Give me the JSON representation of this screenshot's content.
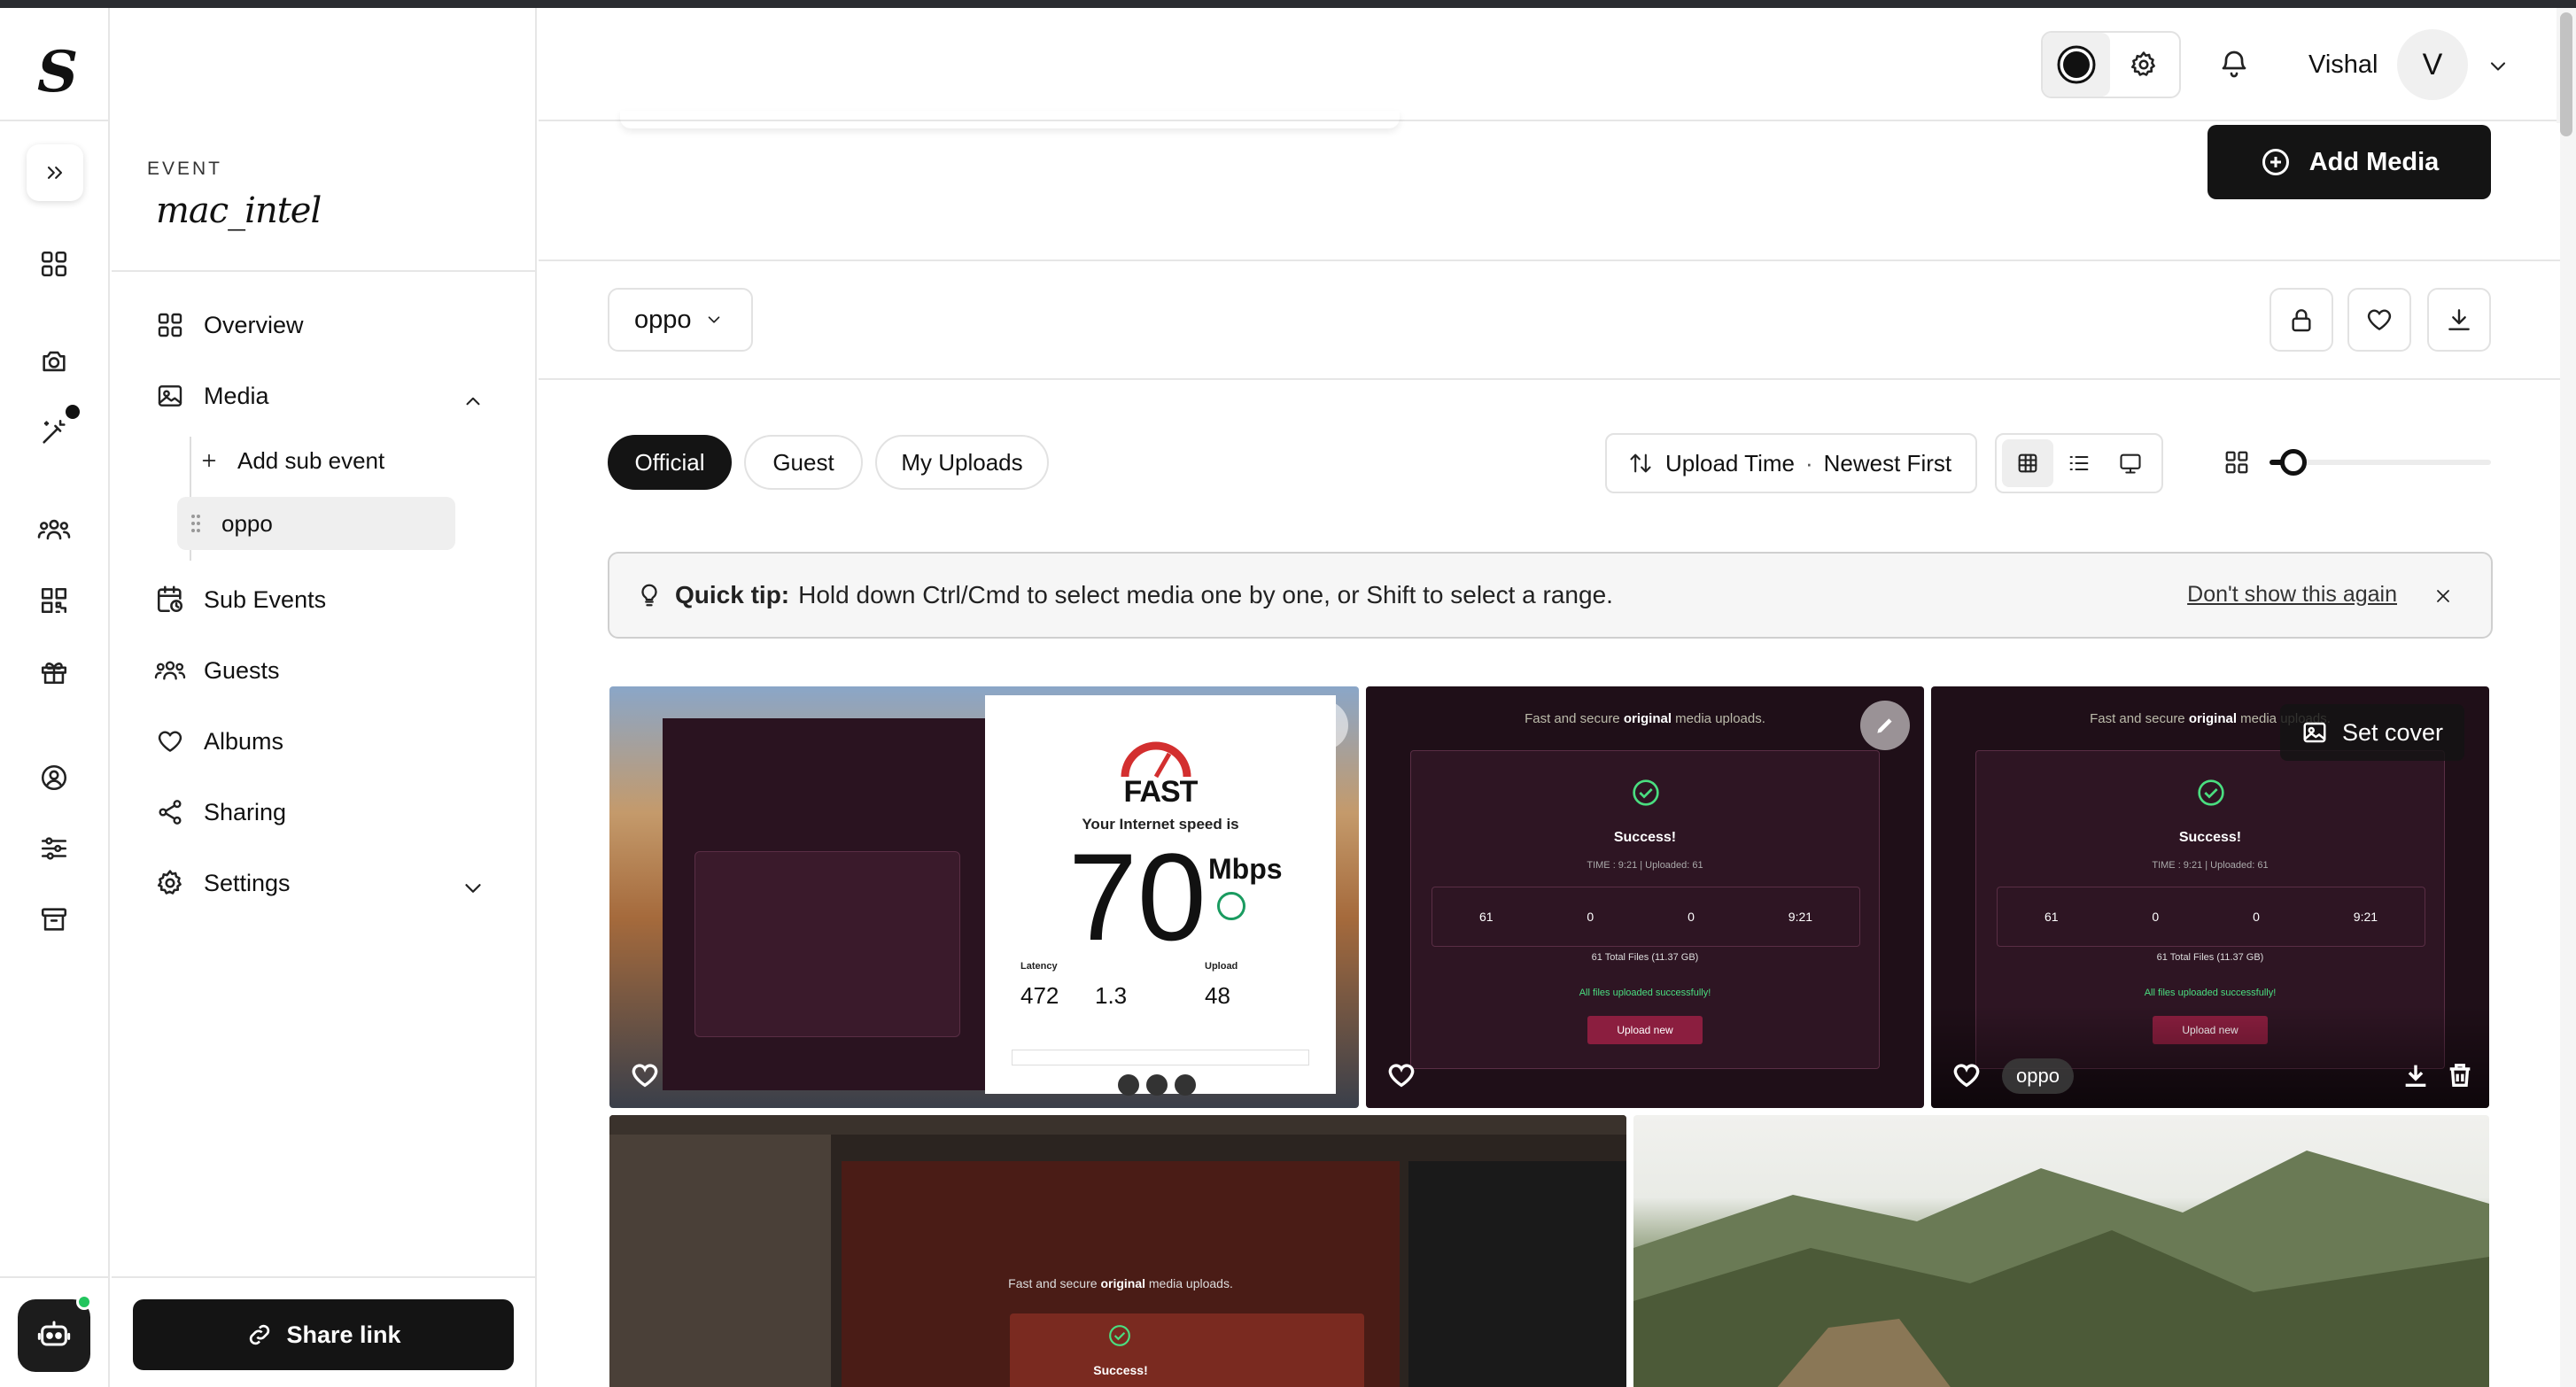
{
  "app": {
    "logo_letter": "S"
  },
  "header": {
    "user_name": "Vishal",
    "avatar_initial": "V"
  },
  "event": {
    "label": "EVENT",
    "name": "mac_intel"
  },
  "nav": {
    "overview": "Overview",
    "media": "Media",
    "add_sub_event": "Add sub event",
    "current_sub_event": "oppo",
    "sub_events": "Sub Events",
    "guests": "Guests",
    "albums": "Albums",
    "sharing": "Sharing",
    "settings": "Settings",
    "share_link": "Share link"
  },
  "toolbar": {
    "add_media": "Add Media",
    "sub_event_select": "oppo"
  },
  "filters": {
    "tabs": [
      {
        "label": "Official",
        "active": true
      },
      {
        "label": "Guest",
        "active": false
      },
      {
        "label": "My Uploads",
        "active": false
      }
    ],
    "sort_field": "Upload Time",
    "sort_dot": "·",
    "sort_order": "Newest First",
    "zoom_level": 0.05
  },
  "tip": {
    "title": "Quick tip:",
    "text": "Hold down Ctrl/Cmd to select media one by one, or Shift to select a range.",
    "dismiss": "Don't show this again"
  },
  "media": {
    "tile1": {
      "fast_logo": "FAST",
      "speed_caption": "Your Internet speed is",
      "speed_value": "70",
      "speed_unit": "Mbps",
      "latency_label": "Latency",
      "upload_label": "Upload",
      "latency_value": "472",
      "loaded_value": "1.3",
      "upload_value": "48"
    },
    "success_tile": {
      "tagline_prefix": "Fast and secure ",
      "tagline_bold": "original",
      "tagline_suffix": " media uploads.",
      "success": "Success!",
      "time_line": "TIME : 9:21 | Uploaded: 61",
      "uploaded_count": "61",
      "skipped_count": "0",
      "failed_count": "0",
      "duration": "9:21",
      "total_files": "61 Total Files (11.37 GB)",
      "all_uploaded": "All files uploaded successfully!",
      "upload_new": "Upload new"
    },
    "tile3": {
      "set_cover": "Set cover",
      "tag": "oppo"
    },
    "tile4": {
      "tagline_prefix": "Fast and secure ",
      "tagline_bold": "original",
      "tagline_suffix": " media uploads.",
      "success": "Success!"
    }
  }
}
